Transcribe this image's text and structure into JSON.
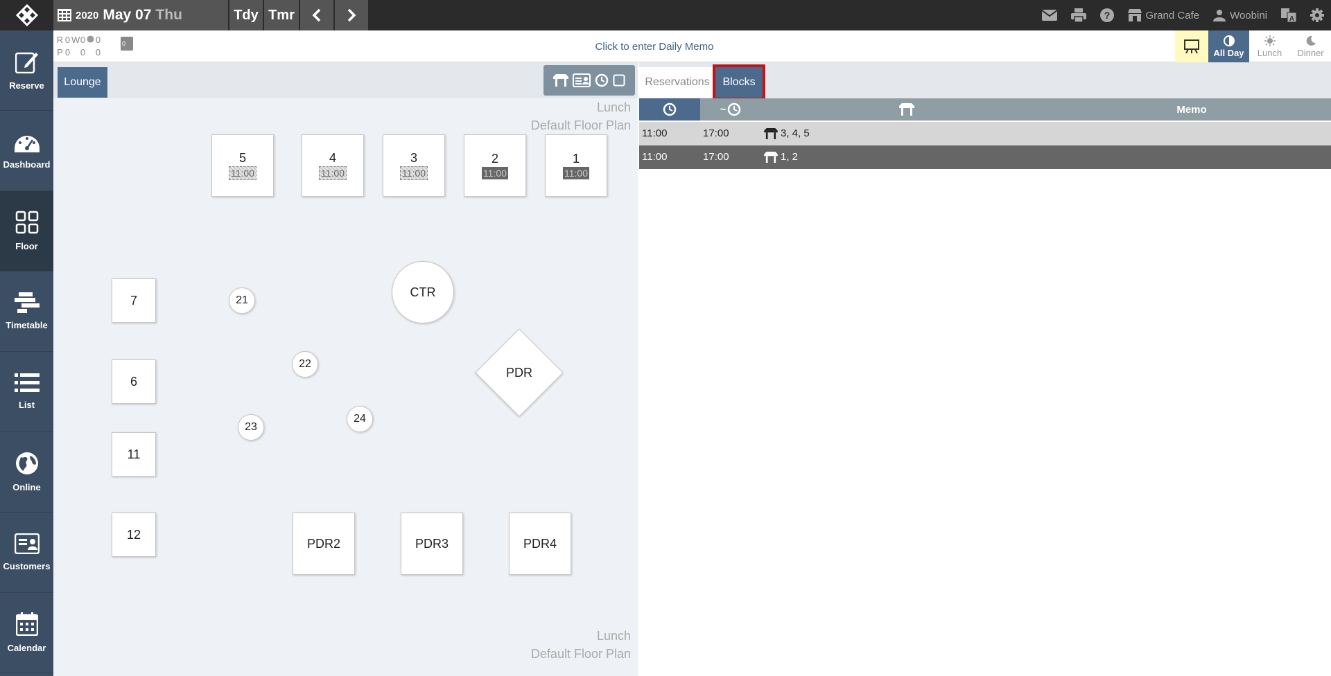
{
  "topbar": {
    "year": "2020",
    "month_day": "May 07",
    "weekday": "Thu",
    "today_label": "Tdy",
    "tomorrow_label": "Tmr",
    "restaurant": "Grand Cafe",
    "user": "Woobini"
  },
  "sidebar": {
    "items": [
      {
        "label": "Reserve"
      },
      {
        "label": "Dashboard"
      },
      {
        "label": "Floor"
      },
      {
        "label": "Timetable"
      },
      {
        "label": "List"
      },
      {
        "label": "Online"
      },
      {
        "label": "Customers"
      },
      {
        "label": "Calendar"
      }
    ]
  },
  "subheader": {
    "counts_r": {
      "label": "R",
      "v1": "0",
      "w": "W",
      "v2": "0",
      "v3": "0"
    },
    "counts_p": {
      "label": "P",
      "v1": "0",
      "v2": "0",
      "v3": "0"
    },
    "memo_badge": "0",
    "daily_memo": "Click to enter Daily Memo",
    "services": [
      "All Day",
      "Lunch",
      "Dinner"
    ]
  },
  "floor": {
    "area_tab": "Lounge",
    "service_label": "Lunch",
    "plan_label": "Default Floor Plan",
    "tables": [
      {
        "name": "5",
        "time": "11:00",
        "style": "hatched"
      },
      {
        "name": "4",
        "time": "11:00",
        "style": "hatched"
      },
      {
        "name": "3",
        "time": "11:00",
        "style": "hatched"
      },
      {
        "name": "2",
        "time": "11:00",
        "style": "solid"
      },
      {
        "name": "1",
        "time": "11:00",
        "style": "solid"
      },
      {
        "name": "7"
      },
      {
        "name": "21"
      },
      {
        "name": "CTR"
      },
      {
        "name": "22"
      },
      {
        "name": "PDR"
      },
      {
        "name": "6"
      },
      {
        "name": "24"
      },
      {
        "name": "23"
      },
      {
        "name": "11"
      },
      {
        "name": "12"
      },
      {
        "name": "PDR2"
      },
      {
        "name": "PDR3"
      },
      {
        "name": "PDR4"
      }
    ]
  },
  "blocks": {
    "tabs": [
      "Reservations",
      "Blocks"
    ],
    "header_memo": "Memo",
    "header_end_prefix": "~",
    "rows": [
      {
        "start": "11:00",
        "end": "17:00",
        "tables": "3, 4, 5"
      },
      {
        "start": "11:00",
        "end": "17:00",
        "tables": "1, 2"
      }
    ]
  }
}
